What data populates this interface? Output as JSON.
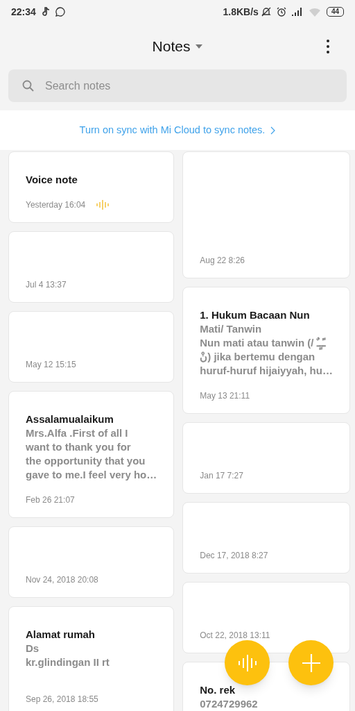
{
  "status_bar": {
    "time": "22:34",
    "speed": "1.8KB/s",
    "battery": "44"
  },
  "header": {
    "title": "Notes"
  },
  "search": {
    "placeholder": "Search notes"
  },
  "sync_banner": {
    "text": "Turn on sync with Mi Cloud to sync notes."
  },
  "columns": [
    [
      {
        "kind": "voice",
        "title": "Voice note",
        "date": "Yesterday 16:04"
      },
      {
        "kind": "note",
        "date": "Jul 4 13:37"
      },
      {
        "kind": "note",
        "date": "May 12 15:15"
      },
      {
        "kind": "note",
        "title": "Assalamualaikum",
        "lines": [
          "Mrs.Alfa .First of all I",
          "want to thank you for",
          "the opportunity that you",
          "gave to me.I feel very ho…"
        ],
        "date": "Feb 26 21:07"
      },
      {
        "kind": "note",
        "date": "Nov 24, 2018 20:08"
      },
      {
        "kind": "note",
        "title": "Alamat rumah",
        "lines": [
          "Ds",
          "kr.glindingan II rt"
        ],
        "date": "Sep 26, 2018 18:55"
      }
    ],
    [
      {
        "kind": "tall",
        "date": "Aug 22 8:26"
      },
      {
        "kind": "note",
        "title": "1. Hukum Bacaan Nun",
        "lines": [
          "Mati/ Tanwin",
          "Nun mati atau tanwin (/ ـًـٍـٌ",
          "نْ) jika bertemu dengan",
          "huruf-huruf hijaiyyah, hu…"
        ],
        "date": "May 13 21:11"
      },
      {
        "kind": "note",
        "date": "Jan 17 7:27"
      },
      {
        "kind": "note",
        "date": "Dec 17, 2018 8:27"
      },
      {
        "kind": "note",
        "date": "Oct 22, 2018 13:11"
      },
      {
        "kind": "note",
        "title": "No. rek",
        "lines": [
          "0724729962"
        ]
      }
    ]
  ]
}
